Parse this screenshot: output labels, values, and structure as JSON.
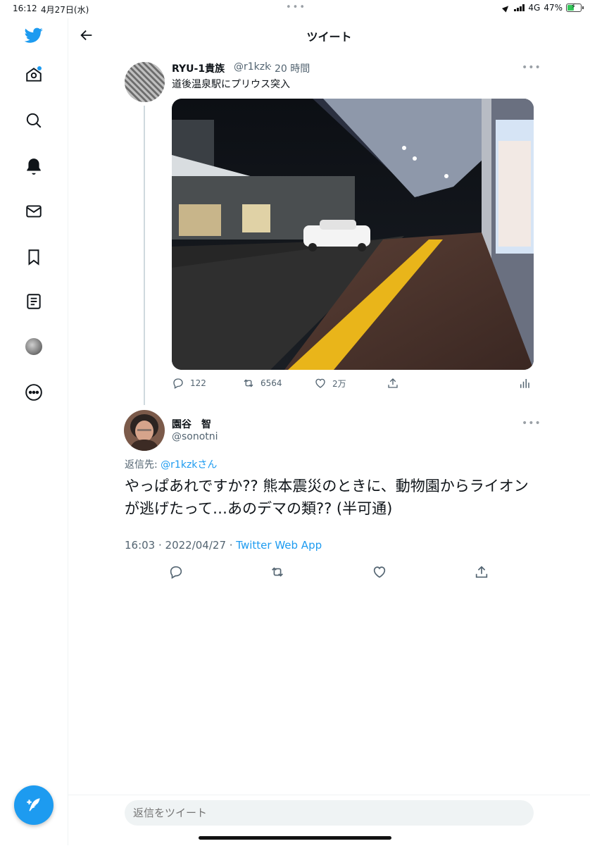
{
  "status_bar": {
    "time": "16:12",
    "date": "4月27日(水)",
    "network": "4G",
    "battery": "47%",
    "battery_level": 0.47
  },
  "header": {
    "title": "ツイート"
  },
  "original_tweet": {
    "name": "RYU-1貴族",
    "handle": "@r1kzk",
    "time": "20 時間",
    "text": "道後温泉駅にプリウス突入",
    "stats": {
      "replies": "122",
      "retweets": "6564",
      "likes": "2万"
    }
  },
  "reply_tweet": {
    "name": "園谷　智",
    "handle": "@sonotni",
    "reply_prefix": "返信先:",
    "reply_target": "@r1kzkさん",
    "text": "やっぱあれですか?? 熊本震災のときに、動物園からライオンが逃げたって…あのデマの類?? (半可通)",
    "timestamp": "16:03 · 2022/04/27 · ",
    "source": "Twitter Web App"
  },
  "reply_box": {
    "placeholder": "返信をツイート"
  },
  "icons": {
    "brand": "twitter-bird-icon",
    "nav": [
      "home-icon",
      "search-icon",
      "bell-icon",
      "mail-icon",
      "bookmark-icon",
      "lists-icon",
      "profile-avatar",
      "more-circle-icon"
    ],
    "compose": "compose-feather-icon"
  },
  "colors": {
    "accent": "#1d9bf0",
    "text": "#0f1419",
    "secondary": "#536471"
  }
}
